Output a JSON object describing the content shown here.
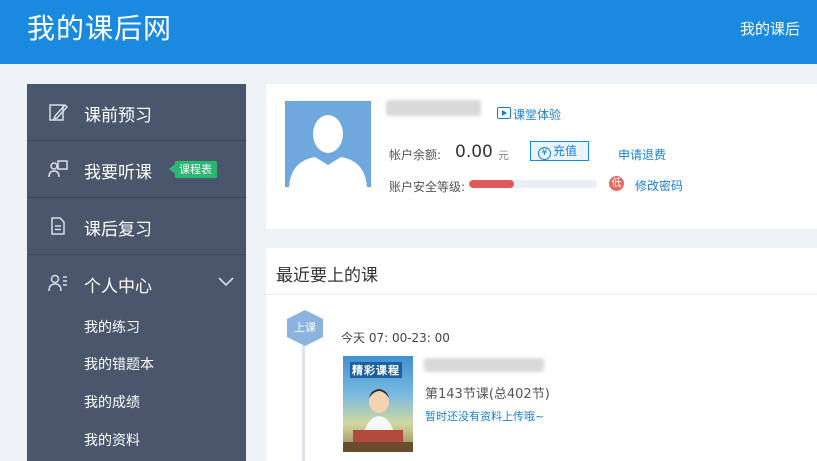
{
  "header": {
    "logo_text": "我的课后网",
    "top_link": "我的课后"
  },
  "sidebar": {
    "items": [
      {
        "label": "课前预习",
        "icon": "edit-icon"
      },
      {
        "label": "我要听课",
        "icon": "listen-icon",
        "badge": "课程表"
      },
      {
        "label": "课后复习",
        "icon": "document-icon"
      },
      {
        "label": "个人中心",
        "icon": "user-list-icon",
        "expanded": true
      }
    ],
    "sub_items": [
      "我的练习",
      "我的错题本",
      "我的成绩",
      "我的资料"
    ]
  },
  "profile": {
    "trial_link": "课堂体验",
    "balance_label": "帐户余额:",
    "balance_value": "0.00",
    "balance_unit": "元",
    "recharge_label": "充值",
    "recharge_icon_char": "¥",
    "refund_link": "申请退费",
    "security_label": "账户安全等级:",
    "security_level": 0.35,
    "security_badge": "低",
    "change_password_link": "修改密码",
    "colors": {
      "accent": "#1a8ae0",
      "danger": "#e15a5a",
      "badge_green": "#2bb673"
    }
  },
  "recent_courses": {
    "title": "最近要上的课",
    "status": "上课",
    "time": "今天 07: 00-23: 00",
    "thumbnail_caption": "精彩课程",
    "lesson": "第143节课(总402节)",
    "no_material": "暂时还没有资料上传哦~"
  }
}
